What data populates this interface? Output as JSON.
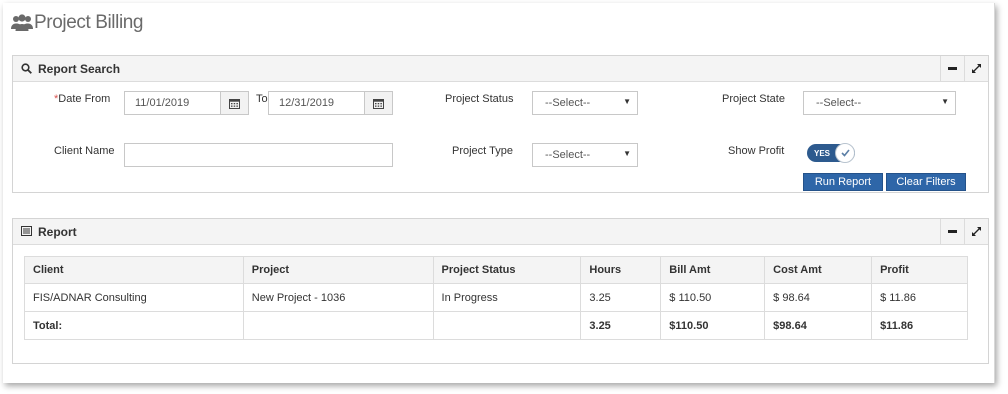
{
  "page": {
    "title": "Project Billing"
  },
  "search_panel": {
    "title": "Report Search",
    "fields": {
      "date_from_required": "*",
      "date_from_label": "Date From",
      "date_from_value": "11/01/2019",
      "to_label": "To",
      "date_to_value": "12/31/2019",
      "project_status_label": "Project Status",
      "project_status_value": "--Select--",
      "project_state_label": "Project State",
      "project_state_value": "--Select--",
      "client_name_label": "Client Name",
      "client_name_value": "",
      "project_type_label": "Project Type",
      "project_type_value": "--Select--",
      "show_profit_label": "Show Profit",
      "show_profit_toggle": "YES"
    },
    "buttons": {
      "run_report": "Run Report",
      "clear_filters": "Clear Filters"
    }
  },
  "report_panel": {
    "title": "Report",
    "table": {
      "headers": [
        "Client",
        "Project",
        "Project Status",
        "Hours",
        "Bill Amt",
        "Cost Amt",
        "Profit"
      ],
      "rows": [
        [
          "FIS/ADNAR Consulting",
          "New Project - 1036",
          "In Progress",
          "3.25",
          "$ 110.50",
          "$ 98.64",
          "$ 11.86"
        ]
      ],
      "total": [
        "Total:",
        "",
        "",
        "3.25",
        "$110.50",
        "$98.64",
        "$11.86"
      ]
    }
  },
  "colors": {
    "primary": "#2e66a8",
    "toggle": "#2d5a8e",
    "required": "#d9534f"
  }
}
